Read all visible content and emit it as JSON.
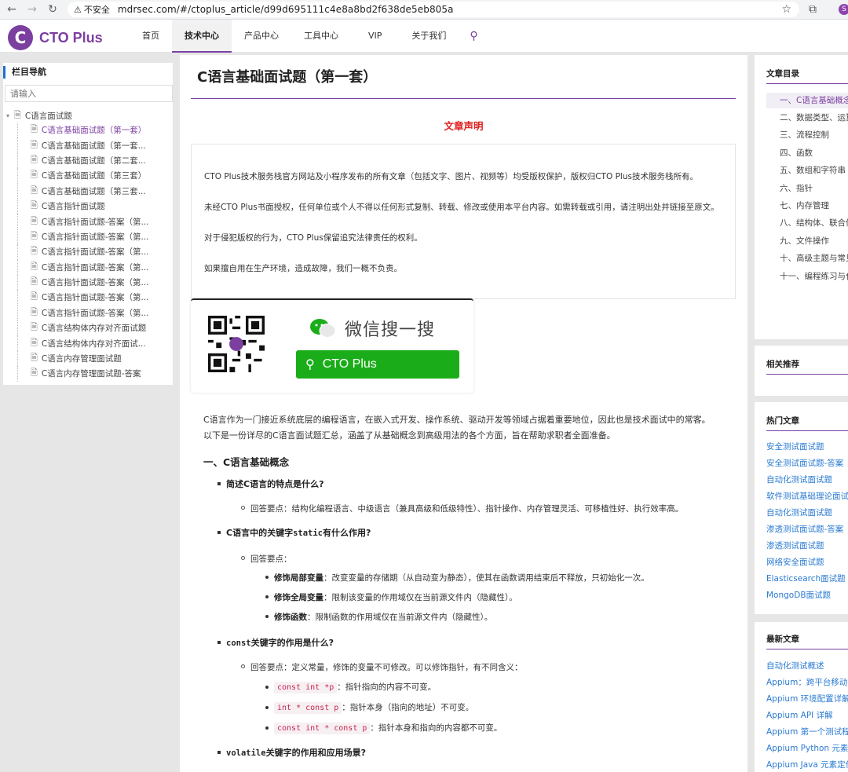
{
  "browser": {
    "back": "←",
    "forward": "→",
    "reload": "↻",
    "warning": "不安全",
    "url": "mdrsec.com/#/ctoplus_article/d99d695111c4e8a8bd2f638de5eb805a",
    "profile": "S"
  },
  "site": {
    "logo_mark": "C",
    "logo_text": "CTO Plus",
    "menu": [
      "首页",
      "技术中心",
      "产品中心",
      "工具中心",
      "VIP",
      "关于我们"
    ],
    "active_menu": "技术中心"
  },
  "left": {
    "title": "栏目导航",
    "search_placeholder": "请输入",
    "root": "C语言面试题",
    "items": [
      "C语言基础面试题（第一套）",
      "C语言基础面试题（第一套...",
      "C语言基础面试题（第二套...",
      "C语言基础面试题（第三套）",
      "C语言基础面试题（第三套...",
      "C语言指针面试题",
      "C语言指针面试题-答案（第...",
      "C语言指针面试题-答案（第...",
      "C语言指针面试题-答案（第...",
      "C语言指针面试题-答案（第...",
      "C语言指针面试题-答案（第...",
      "C语言指针面试题-答案（第...",
      "C语言指针面试题-答案（第...",
      "C语言结构体内存对齐面试题",
      "C语言结构体内存对齐面试...",
      "C语言内存管理面试题",
      "C语言内存管理面试题-答案"
    ]
  },
  "article": {
    "title": "C语言基础面试题（第一套）",
    "declaration_title": "文章声明",
    "declaration": [
      "CTO Plus技术服务栈官方网站及小程序发布的所有文章（包括文字、图片、视频等）均受版权保护，版权归CTO Plus技术服务栈所有。",
      "未经CTO Plus书面授权，任何单位或个人不得以任何形式复制、转载、修改或使用本平台内容。如需转载或引用，请注明出处并链接至原文。",
      "对于侵犯版权的行为，CTO Plus保留追究法律责任的权利。",
      "如果擅自用在生产环境，造成故障，我们一概不负责。"
    ],
    "wechat_text": "微信搜一搜",
    "wechat_button": "CTO Plus",
    "intro_1": "C语言作为一门接近系统底层的编程语言，在嵌入式开发、操作系统、驱动开发等领域占据着重要地位，因此也是技术面试中的常客。",
    "intro_2": "以下是一份详尽的C语言面试题汇总，涵盖了从基础概念到高级用法的各个方面，旨在帮助求职者全面准备。",
    "section_1": "一、C语言基础概念",
    "q1": "简述C语言的特点是什么?",
    "q1_answer": "回答要点：结构化编程语言、中级语言（兼具高级和低级特性）、指针操作、内存管理灵活、可移植性好、执行效率高。",
    "q2_pre": "C语言中的关键字",
    "q2_code": "static",
    "q2_post": "有什么作用?",
    "q2_answer_label": "回答要点：",
    "q2_points": [
      {
        "bold": "修饰局部变量",
        "text": "：改变变量的存储期（从自动变为静态），使其在函数调用结束后不释放，只初始化一次。"
      },
      {
        "bold": "修饰全局变量",
        "text": "：限制该变量的作用域仅在当前源文件内（隐藏性）。"
      },
      {
        "bold": "修饰函数",
        "text": "：限制函数的作用域仅在当前源文件内（隐藏性）。"
      }
    ],
    "q3_code": "const",
    "q3_post": "关键字的作用是什么?",
    "q3_answer": "回答要点：定义常量，修饰的变量不可修改。可以修饰指针，有不同含义：",
    "q3_points": [
      {
        "code": "const int *p",
        "text": "：指针指向的内容不可变。"
      },
      {
        "code": "int * const p",
        "text": "：指针本身（指向的地址）不可变。"
      },
      {
        "code": "const int * const p",
        "text": "：指针本身和指向的内容都不可变。"
      }
    ],
    "q4_code": "volatile",
    "q4_post": "关键字的作用和应用场景?"
  },
  "toc": {
    "title": "文章目录",
    "items": [
      "一、C语言基础概念",
      "二、数据类型、运算",
      "三、流程控制",
      "四、函数",
      "五、数组和字符串",
      "六、指针",
      "七、内存管理",
      "八、结构体、联合体",
      "九、文件操作",
      "十、高级主题与常见",
      "十一、编程练习与代"
    ]
  },
  "related": {
    "title": "相关推荐"
  },
  "hot": {
    "title": "热门文章",
    "items": [
      "安全测试面试题",
      "安全测试面试题-答案",
      "自动化测试面试题",
      "软件测试基础理论面试",
      "自动化测试面试题",
      "渗透测试面试题-答案",
      "渗透测试面试题",
      "网络安全面试题",
      "Elasticsearch面试题",
      "MongoDB面试题"
    ]
  },
  "latest": {
    "title": "最新文章",
    "items": [
      "自动化测试概述",
      "Appium：跨平台移动应",
      "Appium 环境配置详解",
      "Appium API 详解",
      "Appium 第一个测试程序",
      "Appium Python 元素定",
      "Appium Java 元素定位"
    ]
  }
}
